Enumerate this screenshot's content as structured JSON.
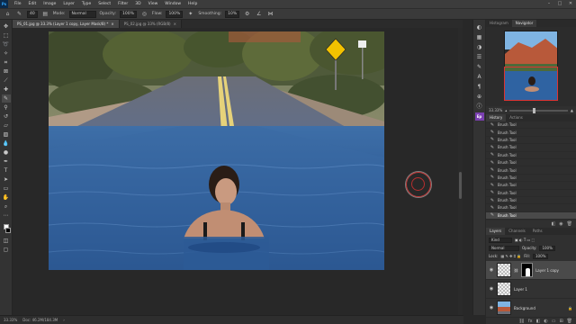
{
  "app": {
    "logo": "Ps"
  },
  "menu": [
    "File",
    "Edit",
    "Image",
    "Layer",
    "Type",
    "Select",
    "Filter",
    "3D",
    "View",
    "Window",
    "Help"
  ],
  "window_controls": [
    "–",
    "□",
    "✕"
  ],
  "options_bar": {
    "mode_label": "Mode:",
    "mode_value": "Normal",
    "opacity_label": "Opacity:",
    "opacity_value": "100%",
    "flow_label": "Flow:",
    "flow_value": "100%",
    "smoothing_label": "Smoothing:",
    "smoothing_value": "10%",
    "brush_size": "40"
  },
  "tabs": [
    {
      "label": "PS_01.jpg @ 33.3% (Layer 1 copy, Layer Mask/8) *",
      "close": "×",
      "active": true
    },
    {
      "label": "PS_02.jpg @ 33% (RGB/8)",
      "close": "×",
      "active": false
    }
  ],
  "status": {
    "zoom": "33.33%",
    "doc_info": "Doc: 46.2M/184.3M"
  },
  "panels": {
    "navigator_tabs": [
      "Histogram",
      "Navigator"
    ],
    "zoom_value": "33.33%",
    "history_tabs": [
      "History",
      "Actions"
    ],
    "history_items": [
      "Brush Tool",
      "Brush Tool",
      "Brush Tool",
      "Brush Tool",
      "Brush Tool",
      "Brush Tool",
      "Brush Tool",
      "Brush Tool",
      "Brush Tool",
      "Brush Tool",
      "Brush Tool",
      "Brush Tool",
      "Brush Tool"
    ],
    "layers_tabs": [
      "Layers",
      "Channels",
      "Paths"
    ],
    "layers_kind": "Kind",
    "blend_mode": "Normal",
    "opacity_label": "Opacity:",
    "opacity_value": "100%",
    "lock_label": "Lock:",
    "fill_label": "Fill:",
    "fill_value": "100%",
    "layers": [
      {
        "name": "Layer 1 copy",
        "active": true
      },
      {
        "name": "Layer 1",
        "active": false
      },
      {
        "name": "Background",
        "active": false
      }
    ]
  },
  "colors": {
    "accent": "#31a8ff",
    "brush_ring": "#c43a3a"
  }
}
